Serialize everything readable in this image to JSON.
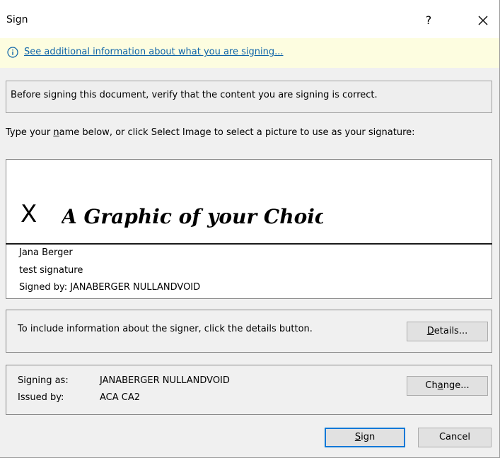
{
  "dialog": {
    "title": "Sign",
    "help_label": "?"
  },
  "info": {
    "link_text": "See additional information about what you are signing..."
  },
  "verify_text": "Before signing this document, verify that the content you are signing is correct.",
  "type_name_label": {
    "before": "Type your ",
    "accel": "n",
    "after": "ame below, or click Select Image to select a picture to use as your signature:"
  },
  "signature": {
    "x_mark": "X",
    "graphic_text": "A Graphic of your Choice",
    "signer_name": "Jana Berger",
    "signer_title": "test signature",
    "signed_by": "Signed by: JANABERGER NULLANDVOID"
  },
  "details": {
    "text": "To include information about the signer, click the details button.",
    "button": {
      "accel": "D",
      "rest": "etails..."
    }
  },
  "signing_as": {
    "label": "Signing as:",
    "value": "JANABERGER NULLANDVOID",
    "issued_label": "Issued by:",
    "issued_value": "ACA CA2",
    "change_button": {
      "before": "Ch",
      "accel": "a",
      "after": "nge..."
    }
  },
  "buttons": {
    "sign": {
      "accel": "S",
      "rest": "ign"
    },
    "cancel": "Cancel"
  },
  "colors": {
    "accent": "#0078d7",
    "link": "#0e64a8",
    "infobar": "#fdfde0"
  }
}
